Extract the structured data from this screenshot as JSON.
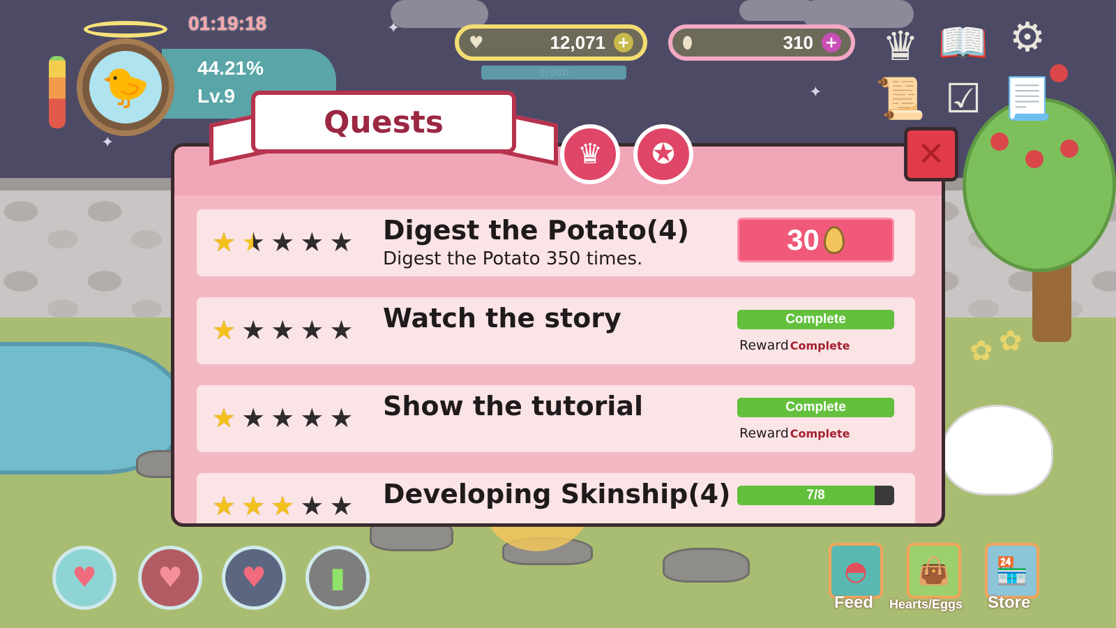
{
  "hud": {
    "clock": "01:19:18",
    "progress_percent": "44.21%",
    "level": "Lv.9",
    "energy_fraction": 0.85,
    "hearts": "12,071",
    "eggs": "310",
    "xp": "0/300"
  },
  "dialog": {
    "title": "Quests",
    "close_symbol": "✕",
    "tabs": [
      {
        "icon": "crown-icon",
        "glyph": "♛"
      },
      {
        "icon": "rosette-icon",
        "glyph": "✪"
      }
    ]
  },
  "quests": [
    {
      "title": "Digest the Potato(4)",
      "description": "Digest the Potato 350 times.",
      "stars": 1.5,
      "reward_value": "30"
    },
    {
      "title": "Watch the story",
      "stars": 1,
      "status": "Complete",
      "reward_label": "Reward",
      "reward_status": "Complete"
    },
    {
      "title": "Show the tutorial",
      "stars": 1,
      "status": "Complete",
      "reward_label": "Reward",
      "reward_status": "Complete"
    },
    {
      "title": "Developing Skinship(4)",
      "stars": 3,
      "progress": "7/8",
      "progress_fraction": 0.875
    }
  ],
  "bottom": {
    "feed_label": "Feed",
    "hearts_eggs_label": "Hearts/Eggs",
    "store_label": "Store"
  },
  "colors": {
    "dialog_bg": "#f4b8c4",
    "reward_pink": "#f0597a",
    "complete_green": "#63c03d",
    "star_gold": "#f4c11c",
    "title_red": "#9b2743"
  }
}
